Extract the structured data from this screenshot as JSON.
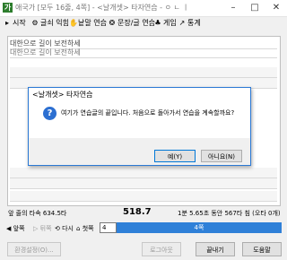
{
  "window": {
    "title": "애국가 [모두 16줄, 4쪽] - <날개셋> 타자연습 - ㅇ ㄴ ㅣ"
  },
  "menu": [
    {
      "icon": "play-icon",
      "glyph": "▸",
      "label": "시작"
    },
    {
      "icon": "gear-icon",
      "glyph": "⚙",
      "label": "글쇠 익힘"
    },
    {
      "icon": "hand-icon",
      "glyph": "✋",
      "label": "낱말 연습"
    },
    {
      "icon": "document-icon",
      "glyph": "❂",
      "label": "문장/글 연습"
    },
    {
      "icon": "game-icon",
      "glyph": "♣",
      "label": "게임"
    },
    {
      "icon": "statistics-icon",
      "glyph": "↗",
      "label": "통계"
    }
  ],
  "typing": {
    "target_line": "대한으로 길이 보전하세",
    "typed_line": "대한으로 길이 보전하세"
  },
  "dialog": {
    "title": "<날개셋> 타자연습",
    "message": "여기가 연습글의 끝입니다. 처음으로 돌아가서 연습을 계속할까요?",
    "yes_label": "예(Y)",
    "no_label": "아니요(N)"
  },
  "status": {
    "left": "앞 줄의 타속 634.5타",
    "speed": "518.7",
    "right": "1분 5.65초 동안 567타 침 (오타 0개)"
  },
  "controls": {
    "prev_label": "앞쪽",
    "back_label": "뒤쪽",
    "again_label": "다시",
    "first_label": "첫쪽",
    "page_count": "4",
    "progress_text": "4쪽",
    "progress_fraction": 1.0
  },
  "buttons": {
    "settings": "환경설정(O)...",
    "log": "로그아웃",
    "finish": "끝내기",
    "help": "도움말"
  },
  "colors": {
    "accent": "#2f80d8",
    "question_icon": "#2c6fd1"
  }
}
